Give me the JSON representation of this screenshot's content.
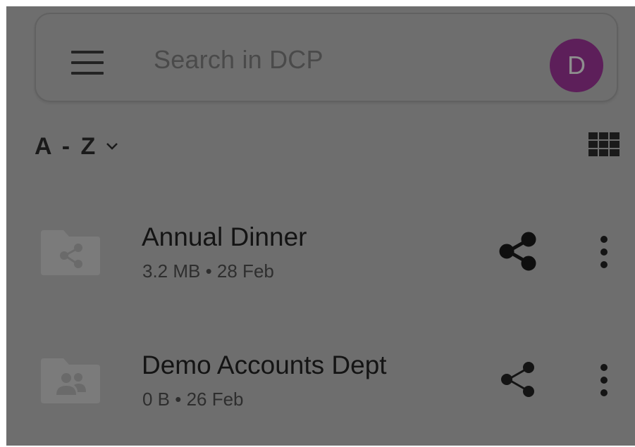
{
  "search": {
    "placeholder": "Search in DCP"
  },
  "account": {
    "avatar_initial": "D",
    "avatar_color": "#5d1f5a"
  },
  "sort": {
    "label": "A - Z"
  },
  "view": {
    "icon": "grid-view-icon"
  },
  "files": [
    {
      "name": "Annual Dinner",
      "size": "3.2 MB",
      "separator": "•",
      "date": "28 Feb",
      "meta": "3.2 MB • 28 Feb",
      "folder_icon": "shared-folder-icon",
      "share_icon": "share-icon",
      "share_bold": true
    },
    {
      "name": "Demo Accounts Dept",
      "size": "0 B",
      "separator": "•",
      "date": "26 Feb",
      "meta": "0 B • 26 Feb",
      "folder_icon": "team-folder-icon",
      "share_icon": "share-icon",
      "share_bold": false
    }
  ],
  "colors": {
    "overlay_background": "#6e6e6e",
    "text_primary": "#141414",
    "text_secondary": "#2e2e2e"
  }
}
